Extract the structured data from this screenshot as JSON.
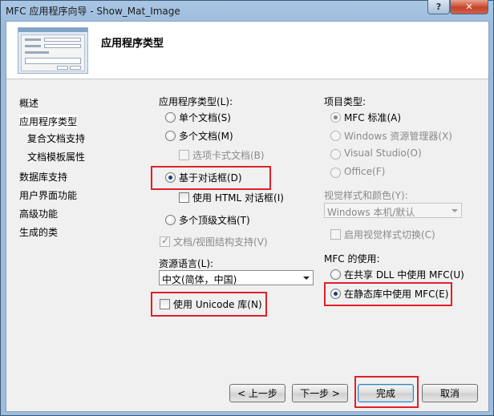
{
  "window": {
    "title": "MFC 应用程序向导 - Show_Mat_Image",
    "help_label": "?",
    "close_label": "✕"
  },
  "header": {
    "title": "应用程序类型"
  },
  "nav": {
    "items": [
      {
        "label": "概述"
      },
      {
        "label": "应用程序类型"
      },
      {
        "label": "复合文档支持"
      },
      {
        "label": "文档模板属性"
      },
      {
        "label": "数据库支持"
      },
      {
        "label": "用户界面功能"
      },
      {
        "label": "高级功能"
      },
      {
        "label": "生成的类"
      }
    ]
  },
  "app_type": {
    "heading": "应用程序类型(L):",
    "single_doc": "单个文档(S)",
    "multi_doc": "多个文档(M)",
    "tabbed_docs": "选项卡式文档(B)",
    "dialog_based": "基于对话框(D)",
    "use_html_dialog": "使用 HTML 对话框(I)",
    "multi_toplevel": "多个顶级文档(T)",
    "doc_view_support": "文档/视图结构支持(V)",
    "selected": "dialog_based"
  },
  "resource_language": {
    "heading": "资源语言(L):",
    "value": "中文(简体，中国)"
  },
  "unicode": {
    "label": "使用 Unicode 库(N)"
  },
  "project_style": {
    "heading": "项目类型:",
    "mfc_standard": "MFC 标准(A)",
    "windows_explorer": "Windows 资源管理器(X)",
    "visual_studio": "Visual Studio(O)",
    "office": "Office(F)"
  },
  "visual_style": {
    "heading": "视觉样式和颜色(Y):",
    "value": "Windows 本机/默认",
    "enable_switch": "启用视觉样式切换(C)"
  },
  "mfc_use": {
    "heading": "MFC 的使用:",
    "shared_dll": "在共享 DLL 中使用 MFC(U)",
    "static_lib": "在静态库中使用 MFC(E)",
    "selected": "static_lib"
  },
  "buttons": {
    "prev": "< 上一步",
    "next": "下一步 >",
    "finish": "完成",
    "cancel": "取消"
  },
  "colors": {
    "highlight_box": "#e0202a",
    "title_bar": "#9dbbdc"
  }
}
